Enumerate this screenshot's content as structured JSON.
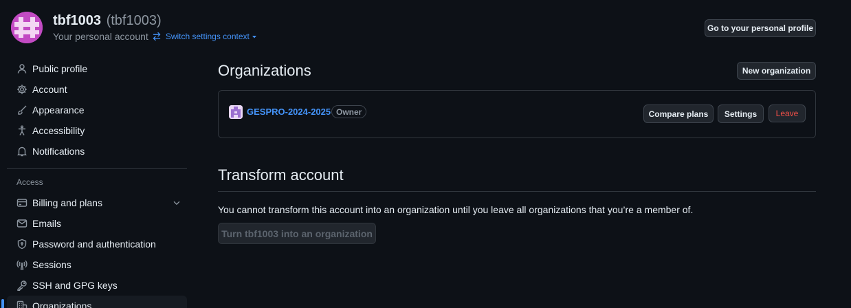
{
  "header": {
    "username": "tbf1003",
    "handle": "(tbf1003)",
    "subtitle": "Your personal account",
    "switch_context": "Switch settings context",
    "profile_button": "Go to your personal profile"
  },
  "sidebar": {
    "items": [
      {
        "label": "Public profile",
        "icon": "person-icon"
      },
      {
        "label": "Account",
        "icon": "gear-icon"
      },
      {
        "label": "Appearance",
        "icon": "paintbrush-icon"
      },
      {
        "label": "Accessibility",
        "icon": "accessibility-icon"
      },
      {
        "label": "Notifications",
        "icon": "bell-icon"
      }
    ],
    "access_label": "Access",
    "access_items": [
      {
        "label": "Billing and plans",
        "icon": "credit-card-icon"
      },
      {
        "label": "Emails",
        "icon": "mail-icon"
      },
      {
        "label": "Password and authentication",
        "icon": "shield-lock-icon"
      },
      {
        "label": "Sessions",
        "icon": "broadcast-icon"
      },
      {
        "label": "SSH and GPG keys",
        "icon": "key-icon"
      },
      {
        "label": "Organizations",
        "icon": "organization-icon"
      }
    ]
  },
  "main": {
    "organizations_title": "Organizations",
    "new_org_button": "New organization",
    "org": {
      "name": "GESPRO-2024-2025",
      "role": "Owner",
      "compare_button": "Compare plans",
      "settings_button": "Settings",
      "leave_button": "Leave"
    },
    "transform_title": "Transform account",
    "transform_text": "You cannot transform this account into an organization until you leave all organizations that you’re a member of.",
    "transform_button": "Turn tbf1003 into an organization"
  },
  "colors": {
    "background": "#0d1117",
    "accent": "#4493f8",
    "danger": "#f85149",
    "avatar": "#c24bc3"
  }
}
